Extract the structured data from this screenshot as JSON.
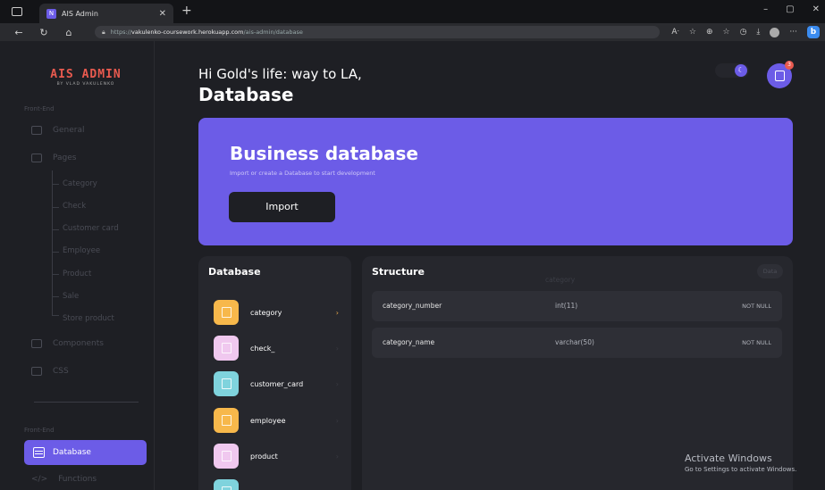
{
  "browser": {
    "tab_title": "AIS Admin",
    "tab_favicon": "N",
    "url_prefix": "https://",
    "url_host": "vakulenko-coursework.herokuapp.com",
    "url_path": "/ais-admin/database"
  },
  "brand": {
    "name": "AIS ADMIN",
    "subtitle": "BY VLAD VAKULENKO"
  },
  "sidebar": {
    "section_1": "Front-End",
    "section_2": "Front-End",
    "items": [
      {
        "label": "General",
        "icon": "grid-icon"
      },
      {
        "label": "Pages",
        "icon": "pages-icon"
      },
      {
        "label": "Components",
        "icon": "components-icon"
      },
      {
        "label": "CSS",
        "icon": "css-icon"
      }
    ],
    "sub_items": [
      "Category",
      "Check",
      "Customer card",
      "Employee",
      "Product",
      "Sale",
      "Store product"
    ],
    "active": {
      "label": "Database",
      "icon": "database-icon"
    },
    "functions": "Functions"
  },
  "header": {
    "greeting": "Hi Gold's life: way to LA,",
    "title": "Database",
    "notification_count": "3"
  },
  "hero": {
    "title": "Business database",
    "subtitle": "Import or create a Database to start development",
    "button": "Import"
  },
  "database": {
    "title": "Database",
    "tables": [
      {
        "name": "category",
        "color": "#f7b84b"
      },
      {
        "name": "check_",
        "color": "#f0c8ef"
      },
      {
        "name": "customer_card",
        "color": "#7fd3dd"
      },
      {
        "name": "employee",
        "color": "#f7b84b"
      },
      {
        "name": "product",
        "color": "#f0c8ef"
      },
      {
        "name": "",
        "color": "#7fd3dd"
      }
    ]
  },
  "structure": {
    "title": "Structure",
    "table_name": "category",
    "data_button": "Data",
    "rows": [
      {
        "name": "category_number",
        "type": "int(11)",
        "null": "NOT NULL"
      },
      {
        "name": "category_name",
        "type": "varchar(50)",
        "null": "NOT NULL"
      }
    ]
  },
  "watermark": {
    "line1": "Activate Windows",
    "line2": "Go to Settings to activate Windows."
  }
}
